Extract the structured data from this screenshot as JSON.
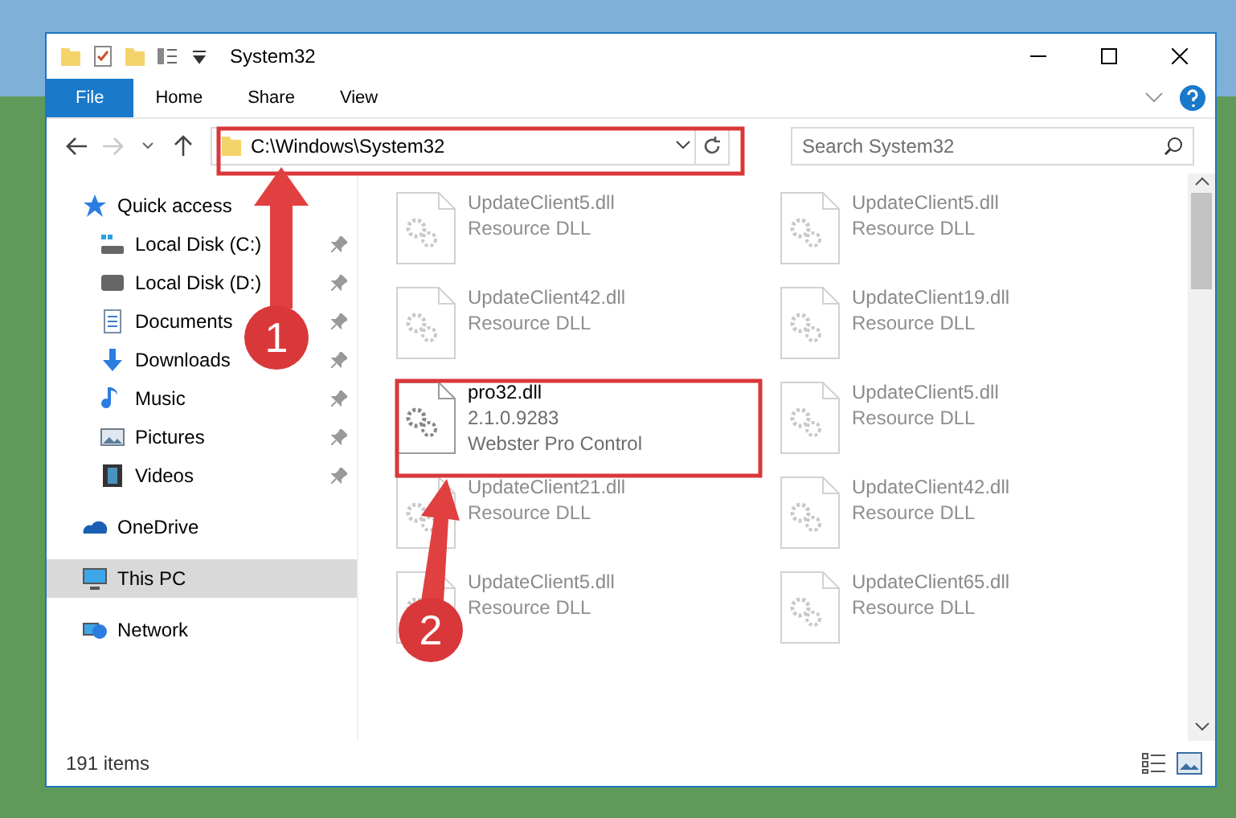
{
  "window": {
    "title": "System32"
  },
  "ribbon_tabs": [
    {
      "label": "File",
      "selected": true
    },
    {
      "label": "Home",
      "selected": false
    },
    {
      "label": "Share",
      "selected": false
    },
    {
      "label": "View",
      "selected": false
    }
  ],
  "address": {
    "value": "C:\\Windows\\System32"
  },
  "search": {
    "placeholder": "Search System32"
  },
  "sidebar": {
    "items": [
      {
        "label": "Quick access",
        "kind": "star",
        "selected": false,
        "children": [
          {
            "label": "Local Disk (C:)",
            "kind": "drive-c",
            "pinned": true,
            "selected": false
          },
          {
            "label": "Local Disk (D:)",
            "kind": "drive",
            "pinned": true,
            "selected": false
          },
          {
            "label": "Documents",
            "kind": "documents",
            "pinned": true,
            "selected": false
          },
          {
            "label": "Downloads",
            "kind": "downloads",
            "pinned": true,
            "selected": false
          },
          {
            "label": "Music",
            "kind": "music",
            "pinned": true,
            "selected": false
          },
          {
            "label": "Pictures",
            "kind": "pictures",
            "pinned": true,
            "selected": false
          },
          {
            "label": "Videos",
            "kind": "videos",
            "pinned": true,
            "selected": false
          }
        ]
      },
      {
        "label": "OneDrive",
        "kind": "cloud",
        "selected": false
      },
      {
        "label": "This PC",
        "kind": "pc",
        "selected": true
      },
      {
        "label": "Network",
        "kind": "network",
        "selected": false
      }
    ]
  },
  "files": [
    {
      "name": "UpdateClient5.dll",
      "details": [
        "Resource DLL"
      ],
      "faded": true
    },
    {
      "name": "UpdateClient5.dll",
      "details": [
        "Resource DLL"
      ],
      "faded": true
    },
    {
      "name": "UpdateClient42.dll",
      "details": [
        "Resource DLL"
      ],
      "faded": true
    },
    {
      "name": "UpdateClient19.dll",
      "details": [
        "Resource DLL"
      ],
      "faded": true
    },
    {
      "name": "pro32.dll",
      "details": [
        "2.1.0.9283",
        "Webster Pro Control"
      ],
      "faded": false
    },
    {
      "name": "UpdateClient5.dll",
      "details": [
        "Resource DLL"
      ],
      "faded": true
    },
    {
      "name": "UpdateClient21.dll",
      "details": [
        "Resource DLL"
      ],
      "faded": true
    },
    {
      "name": "UpdateClient42.dll",
      "details": [
        "Resource DLL"
      ],
      "faded": true
    },
    {
      "name": "UpdateClient5.dll",
      "details": [
        "Resource DLL"
      ],
      "faded": true
    },
    {
      "name": "UpdateClient65.dll",
      "details": [
        "Resource DLL"
      ],
      "faded": true
    }
  ],
  "status_bar": {
    "count": "191 items"
  },
  "annotations": [
    {
      "label": "1"
    },
    {
      "label": "2"
    }
  ]
}
